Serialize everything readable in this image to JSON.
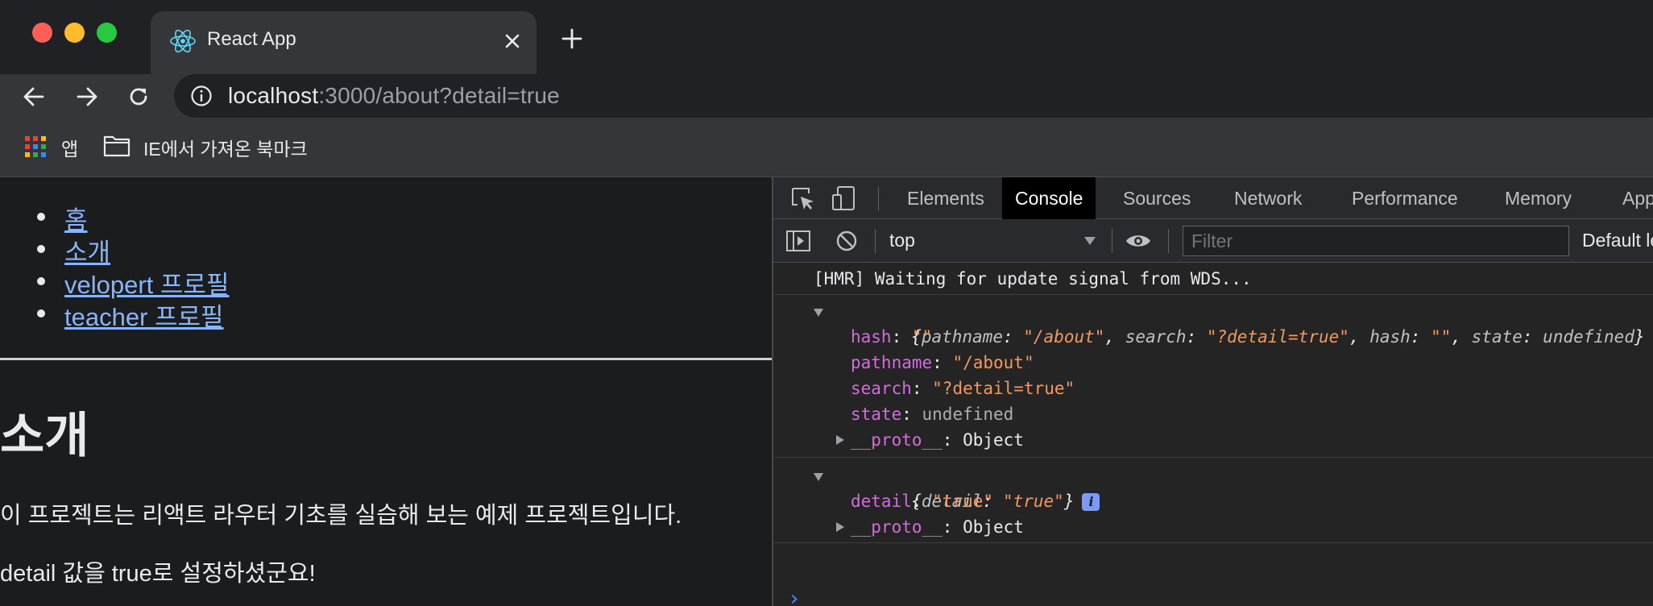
{
  "browser": {
    "tab": {
      "title": "React App",
      "favicon": "react-logo-icon"
    },
    "url": {
      "host": "localhost",
      "rest": ":3000/about?detail=true"
    },
    "bookmarks": [
      {
        "icon": "apps-grid-icon",
        "label": "앱"
      },
      {
        "icon": "folder-icon",
        "label": "IE에서 가져온 북마크"
      }
    ]
  },
  "page": {
    "nav": [
      "홈",
      "소개",
      "velopert 프로필",
      "teacher 프로필"
    ],
    "heading": "소개",
    "paragraph1": "이 프로젝트는 리액트 라우터 기초를 실습해 보는 예제 프로젝트입니다.",
    "paragraph2": "detail 값을 true로 설정하셨군요!"
  },
  "devtools": {
    "tabs": [
      "Elements",
      "Console",
      "Sources",
      "Network",
      "Performance",
      "Memory",
      "Application"
    ],
    "active_tab": "Console",
    "context": "top",
    "filter_placeholder": "Filter",
    "levels": "Default levels",
    "console": {
      "hmr": "[HMR] Waiting for update signal from WDS...",
      "obj1": {
        "open": "{",
        "k1": "pathname",
        "v1": "\"/about\"",
        "k2": "search",
        "v2": "\"?detail=true\"",
        "k3": "hash",
        "v3": "\"\"",
        "k4": "state",
        "v4": "undefined",
        "close": "}",
        "props": [
          {
            "key": "hash",
            "value": "\"\""
          },
          {
            "key": "pathname",
            "value": "\"/about\""
          },
          {
            "key": "search",
            "value": "\"?detail=true\""
          },
          {
            "key": "state",
            "value": "undefined"
          }
        ],
        "proto_key": "__proto__",
        "proto_value": "Object"
      },
      "obj2": {
        "open": "{",
        "k1": "detail",
        "v1": "\"true\"",
        "close": "}",
        "props": [
          {
            "key": "detail",
            "value": "\"true\""
          }
        ],
        "proto_key": "__proto__",
        "proto_value": "Object"
      },
      "info_badge": "i",
      "prompt": "›"
    }
  },
  "colors": {
    "link": "#8ab4f8",
    "console_key": "#ce70d6",
    "console_string": "#ee9a62",
    "info_badge": "#7b9af6",
    "prompt": "#4f88ff"
  }
}
